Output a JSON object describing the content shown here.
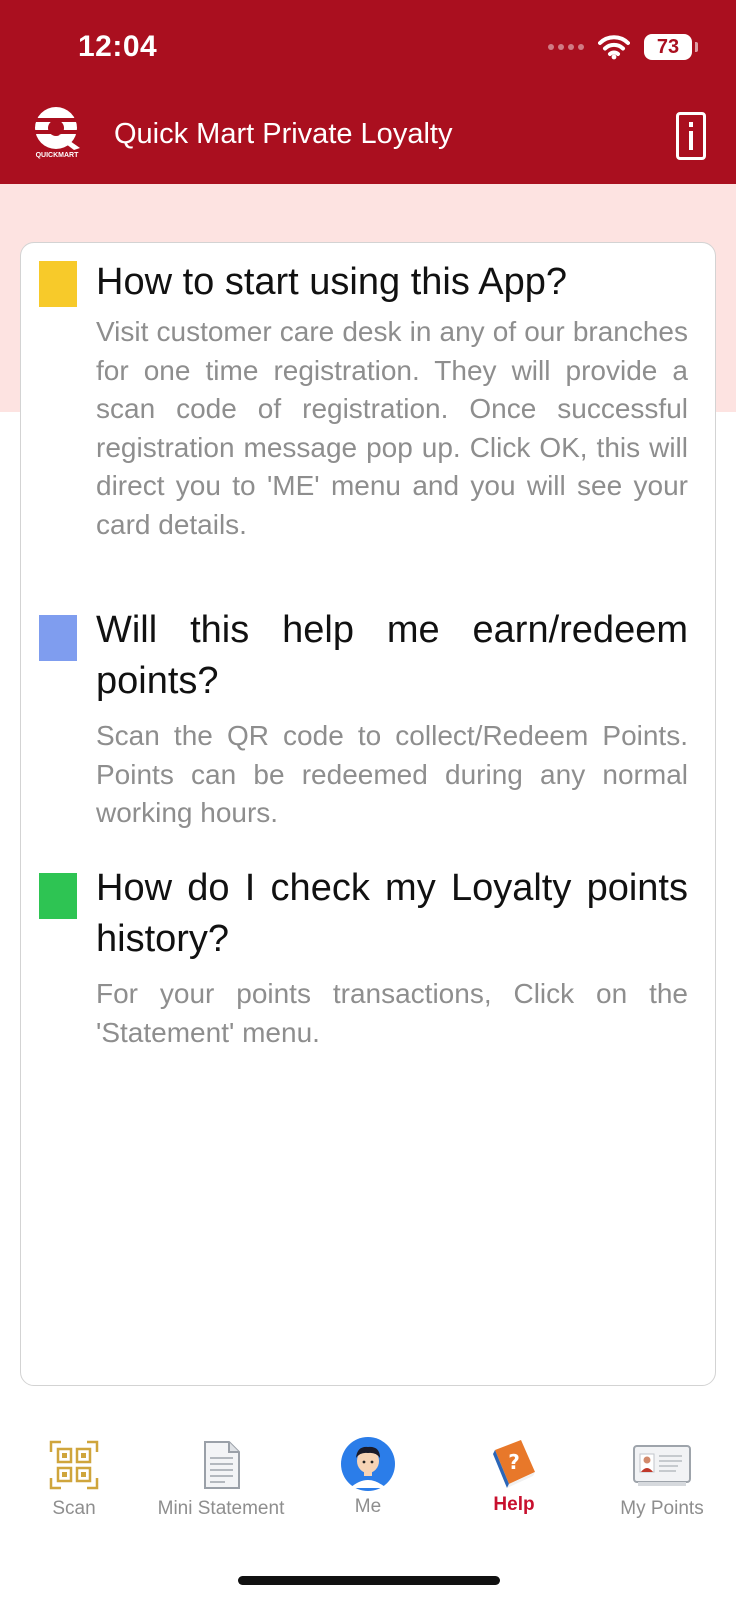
{
  "status": {
    "time": "12:04",
    "battery": "73"
  },
  "header": {
    "title": "Quick Mart Private Loyalty",
    "logo_text": "QUICKMART"
  },
  "faqs": [
    {
      "question": "How to start using this App?",
      "answer": "Visit customer care desk in any of our branches for one time registration. They will provide a scan code of registration. Once successful registration message pop up. Click OK, this will direct you to 'ME' menu and you will see your card details.",
      "color": "#f7ca2a"
    },
    {
      "question": "Will this help me earn/redeem points?",
      "answer": "Scan the QR code to collect/Redeem Points. Points can be redeemed during any normal working hours.",
      "color": "#7f9def"
    },
    {
      "question": "How do I check my Loyalty points history?",
      "answer": "For your points transactions, Click on the 'Statement' menu.",
      "color": "#2ec453"
    }
  ],
  "tabs": [
    {
      "label": "Scan",
      "icon": "qr-code-icon"
    },
    {
      "label": "Mini Statement",
      "icon": "document-icon"
    },
    {
      "label": "Me",
      "icon": "avatar-icon"
    },
    {
      "label": "Help",
      "icon": "help-book-icon",
      "active": true
    },
    {
      "label": "My Points",
      "icon": "id-card-icon"
    }
  ],
  "colors": {
    "header": "#aa0f1f",
    "band": "#fde3e1",
    "active_tab": "#c8102e"
  }
}
